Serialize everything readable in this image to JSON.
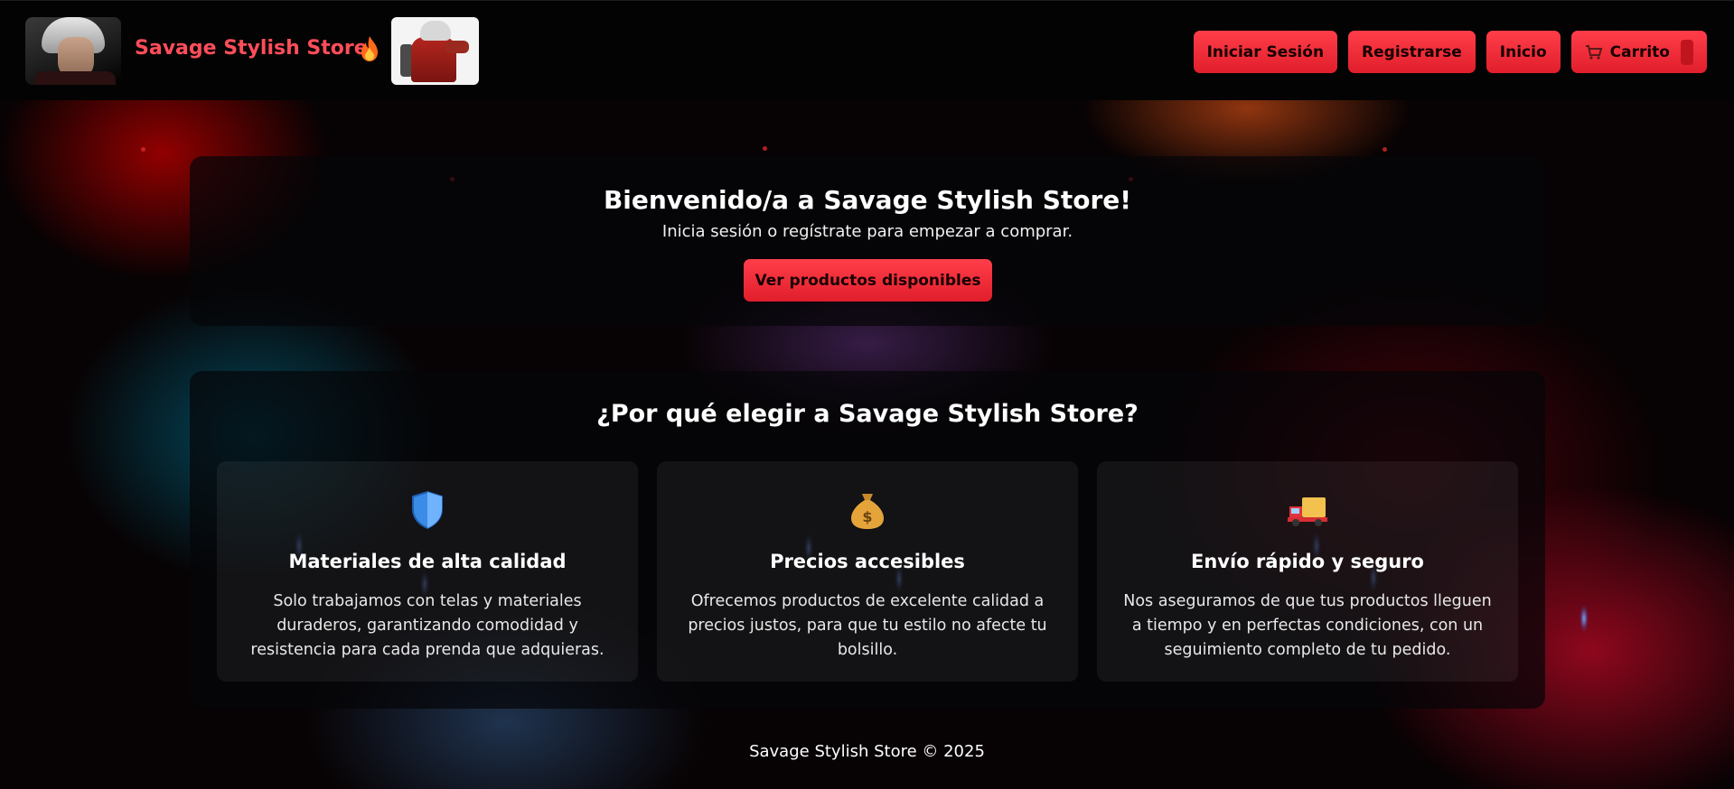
{
  "header": {
    "brand": "Savage Stylish Store",
    "brand_icon": "fire-icon",
    "avatar_left": "character-portrait-1",
    "avatar_right": "character-portrait-2",
    "nav": {
      "login_label": "Iniciar Sesión",
      "register_label": "Registrarse",
      "home_label": "Inicio",
      "cart_label": "Carrito",
      "cart_icon": "cart-icon"
    }
  },
  "welcome": {
    "title": "Bienvenido/a a Savage Stylish Store!",
    "subtitle": "Inicia sesión o regístrate para empezar a comprar.",
    "cta_label": "Ver productos disponibles"
  },
  "why": {
    "title": "¿Por qué elegir a Savage Stylish Store?",
    "features": [
      {
        "icon": "shield-icon",
        "title": "Materiales de alta calidad",
        "text": "Solo trabajamos con telas y materiales duraderos, garantizando comodidad y resistencia para cada prenda que adquieras."
      },
      {
        "icon": "money-bag-icon",
        "title": "Precios accesibles",
        "text": "Ofrecemos productos de excelente calidad a precios justos, para que tu estilo no afecte tu bolsillo."
      },
      {
        "icon": "delivery-truck-icon",
        "title": "Envío rápido y seguro",
        "text": "Nos aseguramos de que tus productos lleguen a tiempo y en perfectas condiciones, con un seguimiento completo de tu pedido."
      }
    ]
  },
  "footer": {
    "text": "Savage Stylish Store © 2025"
  },
  "colors": {
    "accent": "#ff3e4a",
    "brand_text": "#ff4d5a",
    "background": "#070203"
  }
}
